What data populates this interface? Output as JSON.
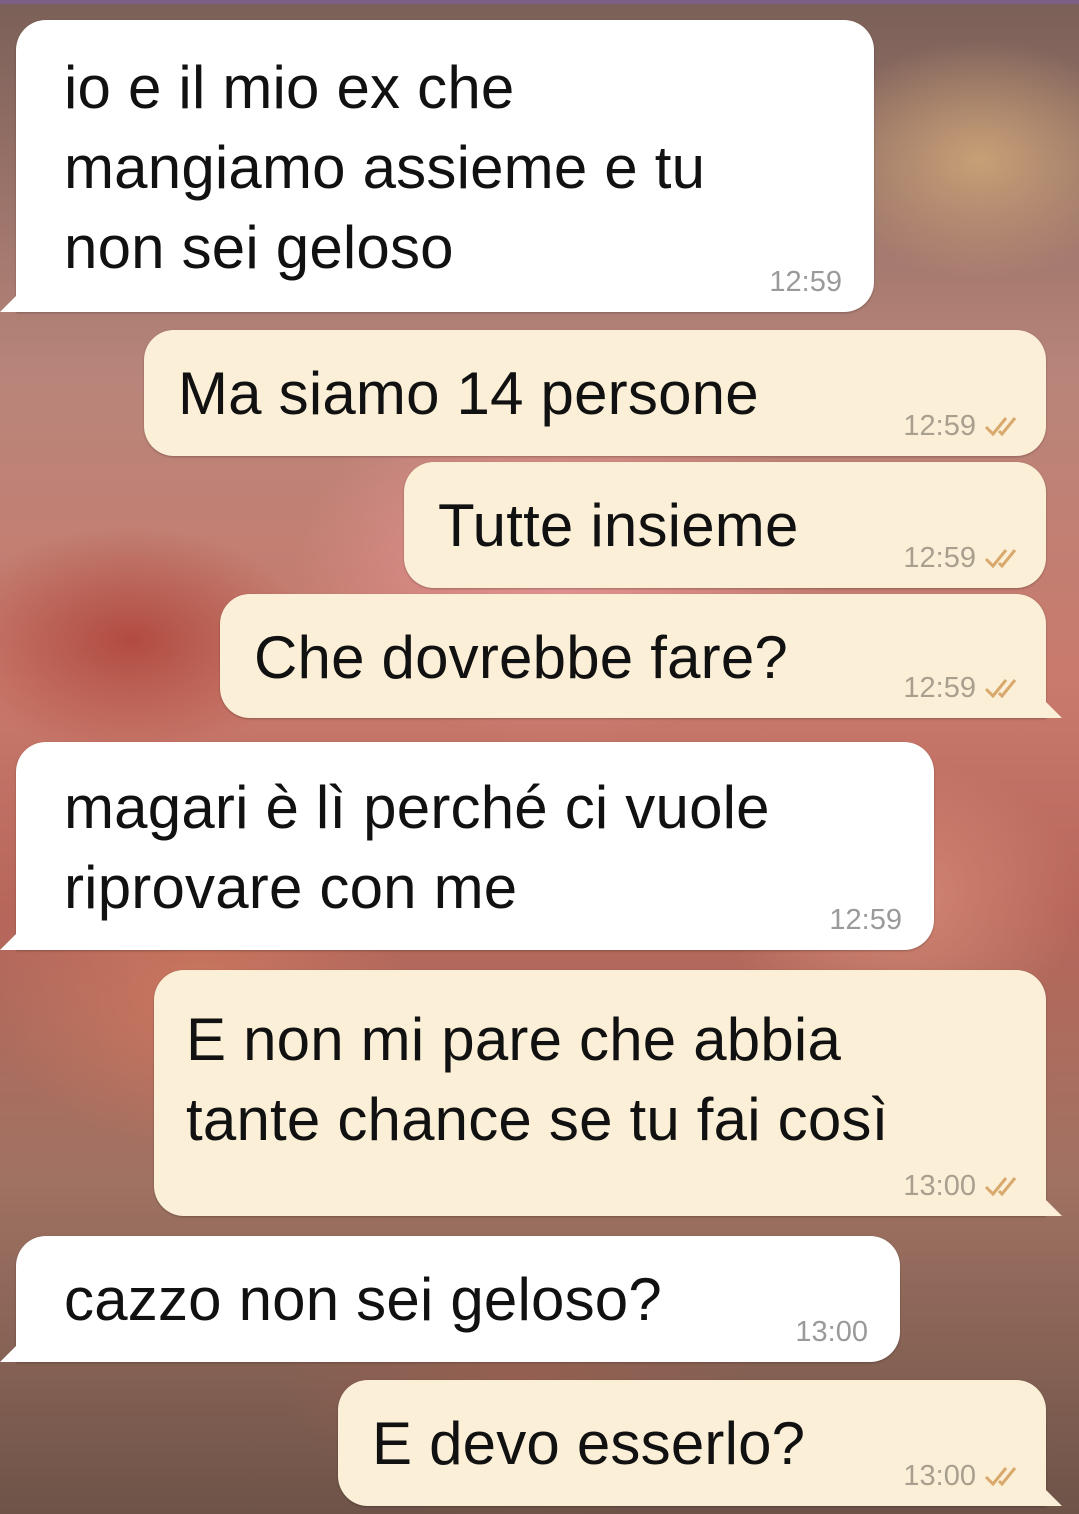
{
  "colors": {
    "incoming_bubble": "#ffffff",
    "outgoing_bubble": "#fbf0d7",
    "tick_read": "#d9a86c",
    "timestamp": "#9a9a9a"
  },
  "messages": [
    {
      "direction": "incoming",
      "text": "io e il mio ex che\nmangiamo assieme e tu\nnon sei geloso",
      "time": "12:59"
    },
    {
      "direction": "outgoing",
      "text": "Ma siamo 14 persone",
      "time": "12:59",
      "status_icon": "double-check-icon"
    },
    {
      "direction": "outgoing",
      "text": "Tutte insieme",
      "time": "12:59",
      "status_icon": "double-check-icon"
    },
    {
      "direction": "outgoing",
      "text": "Che dovrebbe fare?",
      "time": "12:59",
      "status_icon": "double-check-icon"
    },
    {
      "direction": "incoming",
      "text": "magari è lì perché ci vuole\nriprovare con me",
      "time": "12:59"
    },
    {
      "direction": "outgoing",
      "text": "E non mi pare che abbia\ntante chance se tu fai così",
      "time": "13:00",
      "status_icon": "double-check-icon"
    },
    {
      "direction": "incoming",
      "text": "cazzo non sei geloso?",
      "time": "13:00"
    },
    {
      "direction": "outgoing",
      "text": "E devo esserlo?",
      "time": "13:00",
      "status_icon": "double-check-icon"
    }
  ]
}
